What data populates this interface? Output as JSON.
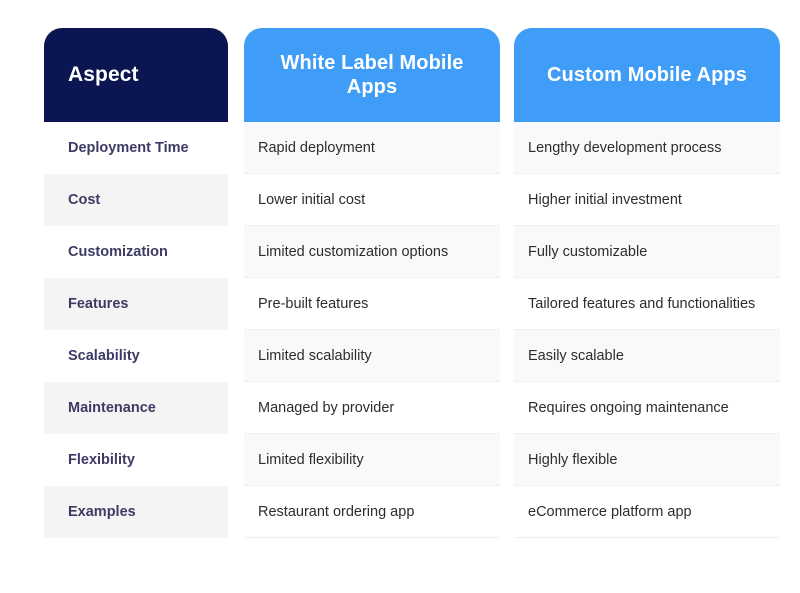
{
  "table": {
    "columns": [
      {
        "id": "aspect",
        "header": "Aspect",
        "header_bg": "#0a1551",
        "header_text_color": "#ffffff"
      },
      {
        "id": "white_label",
        "header": "White Label Mobile Apps",
        "header_bg": "#3f9df7",
        "header_text_color": "#ffffff"
      },
      {
        "id": "custom",
        "header": "Custom Mobile Apps",
        "header_bg": "#3f9df7",
        "header_text_color": "#ffffff"
      }
    ],
    "rows": [
      {
        "aspect": "Deployment Time",
        "white_label": "Rapid deployment",
        "custom": "Lengthy development process"
      },
      {
        "aspect": "Cost",
        "white_label": "Lower initial cost",
        "custom": "Higher initial investment"
      },
      {
        "aspect": "Customization",
        "white_label": "Limited customization options",
        "custom": "Fully customizable"
      },
      {
        "aspect": "Features",
        "white_label": "Pre-built features",
        "custom": "Tailored features and functionalities"
      },
      {
        "aspect": "Scalability",
        "white_label": "Limited scalability",
        "custom": "Easily scalable"
      },
      {
        "aspect": "Maintenance",
        "white_label": "Managed by provider",
        "custom": "Requires ongoing maintenance"
      },
      {
        "aspect": "Flexibility",
        "white_label": "Limited flexibility",
        "custom": "Highly flexible"
      },
      {
        "aspect": "Examples",
        "white_label": "Restaurant ordering app",
        "custom": "eCommerce platform app"
      }
    ],
    "colors": {
      "page_background": "#ffffff",
      "aspect_header_bg": "#0a1551",
      "value_header_bg": "#3f9df7",
      "aspect_label_text": "#3d3b63",
      "value_text": "#2d2d2d",
      "aspect_row_shade": "#f6f3f4",
      "value_row_shade": "#f8f9fb",
      "row_divider": "#eceef1"
    }
  }
}
